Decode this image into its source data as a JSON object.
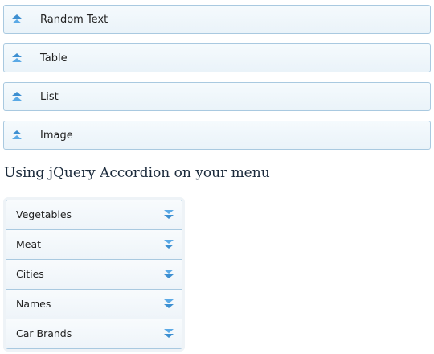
{
  "accordion": {
    "items": [
      {
        "label": "Random Text",
        "icon": "chevron-double-up-icon"
      },
      {
        "label": "Table",
        "icon": "chevron-double-up-icon"
      },
      {
        "label": "List",
        "icon": "chevron-double-up-icon"
      },
      {
        "label": "Image",
        "icon": "chevron-double-up-icon"
      }
    ]
  },
  "section": {
    "heading": "Using jQuery Accordion on your menu"
  },
  "menu": {
    "items": [
      {
        "label": "Vegetables",
        "icon": "chevron-double-down-icon"
      },
      {
        "label": "Meat",
        "icon": "chevron-double-down-icon"
      },
      {
        "label": "Cities",
        "icon": "chevron-double-down-icon"
      },
      {
        "label": "Names",
        "icon": "chevron-double-down-icon"
      },
      {
        "label": "Car Brands",
        "icon": "chevron-double-down-icon"
      }
    ]
  },
  "colors": {
    "border": "#a9c9e0",
    "header_bg": "#eaf3f9",
    "icon": "#3d8fd1",
    "heading_text": "#1c2b3c"
  }
}
